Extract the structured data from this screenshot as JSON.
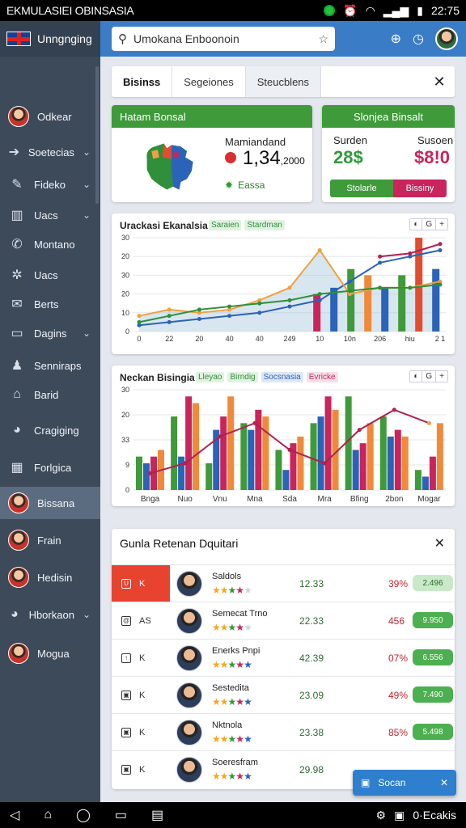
{
  "status_bar": {
    "title": "EKMULASIEI OBINSASIA",
    "time": "22:75",
    "icons": [
      "record-icon",
      "alarm-icon",
      "wifi-icon",
      "signal-icon",
      "battery-icon"
    ]
  },
  "sidebar": {
    "header_label": "Unngnging",
    "items": [
      {
        "label": "Odkear",
        "icon": "avatar",
        "chevron": false
      },
      {
        "label": "Soetecias",
        "icon": "arrow-icon",
        "chevron": true
      },
      {
        "label": "Fideko",
        "icon": "pen-icon",
        "chevron": true
      },
      {
        "label": "Uacs",
        "icon": "chart-icon",
        "chevron": true
      },
      {
        "label": "Montano",
        "icon": "phone-icon",
        "chevron": false
      },
      {
        "label": "Uacs",
        "icon": "gear-icon",
        "chevron": false
      },
      {
        "label": "Berts",
        "icon": "mail-icon",
        "chevron": false
      },
      {
        "label": "Dagins",
        "icon": "monitor-icon",
        "chevron": true
      },
      {
        "label": "Senniraps",
        "icon": "user-icon",
        "chevron": false
      },
      {
        "label": "Barid",
        "icon": "home-icon",
        "chevron": false
      },
      {
        "label": "Cragiging",
        "icon": "colorwheel-icon",
        "chevron": false
      },
      {
        "label": "Forlgica",
        "icon": "grid-icon",
        "chevron": false
      },
      {
        "label": "Bissana",
        "icon": "avatar",
        "chevron": false
      },
      {
        "label": "Frain",
        "icon": "avatar",
        "chevron": false
      },
      {
        "label": "Hedisin",
        "icon": "avatar",
        "chevron": false
      },
      {
        "label": "Hborkaon",
        "icon": "colorwheel-icon",
        "chevron": true
      },
      {
        "label": "Mogua",
        "icon": "avatar",
        "chevron": false
      }
    ]
  },
  "topbar": {
    "search_value": "Umokana Enboonoin"
  },
  "tabs": [
    "Bisinss",
    "Segeiones",
    "Steucblens"
  ],
  "kpi_left": {
    "header": "Hatam Bonsal",
    "label": "Mamiandand",
    "value": "1,34",
    "value_suffix": ",2000",
    "sub": "Eassa"
  },
  "kpi_right": {
    "header": "Slonjea Binsalt",
    "col1_label": "Surden",
    "col1_value": "28$",
    "col2_label": "Susoen",
    "col2_value": "$8!0",
    "btn1": "Stolarle",
    "btn2": "Bissiny",
    "colors": {
      "value1": "#2f9a3a",
      "value2": "#c9245c",
      "btn1": "#3f9a3a",
      "btn2": "#c9245c"
    }
  },
  "chart1_tools": [
    "◐",
    "G",
    "+"
  ],
  "chart2_tools": [
    "◐",
    "G",
    "+"
  ],
  "chart_data": [
    {
      "type": "line",
      "title": "Urackasi Ekanalsia",
      "legend": [
        {
          "name": "Saraien",
          "color": "#3f9a3a"
        },
        {
          "name": "Stardman",
          "color": "#3f9a3a"
        }
      ],
      "x_ticks": [
        "0",
        "22",
        "20",
        "40",
        "40",
        "249",
        "10",
        "10n",
        "206",
        "hiu",
        "2 1"
      ],
      "y_ticks": [
        "0",
        "10",
        "20",
        "30",
        "20",
        "30"
      ],
      "ylim": [
        0,
        30
      ],
      "series": [
        {
          "color": "#2a63b8",
          "values": [
            2,
            3,
            4,
            5,
            6,
            8,
            10,
            16,
            22,
            24,
            26
          ]
        },
        {
          "color": "#f0a040",
          "values": [
            5,
            7,
            6,
            7,
            10,
            14,
            26,
            12,
            14,
            14,
            16
          ]
        },
        {
          "color": "#2f8f3a",
          "values": [
            3,
            5,
            7,
            8,
            9,
            10,
            12,
            13,
            14,
            14,
            15
          ]
        },
        {
          "color": "#b0214e",
          "values": [
            null,
            null,
            null,
            null,
            null,
            null,
            null,
            null,
            24,
            25,
            28
          ]
        }
      ],
      "bars": {
        "categories": [
          "10",
          "10n",
          "10n",
          "206",
          "206",
          "hiu",
          "hiu",
          "2 1"
        ],
        "colors": [
          "#c9245c",
          "#2a63b8",
          "#3f9a3a",
          "#f08a3a",
          "#2a63b8",
          "#3f9a3a",
          "#e24d2f",
          "#2a63b8"
        ],
        "values": [
          12,
          14,
          20,
          18,
          14,
          18,
          30,
          20
        ]
      }
    },
    {
      "type": "bar",
      "title": "Neckan Bisingia",
      "legend": [
        {
          "name": "Lleyao",
          "color": "#3f9a3a"
        },
        {
          "name": "Birndig",
          "color": "#3f9a3a"
        },
        {
          "name": "Socsnasia",
          "color": "#2a63b8"
        },
        {
          "name": "Evricke",
          "color": "#c9245c"
        }
      ],
      "categories": [
        "Bnga",
        "Nuo",
        "Vnu",
        "Mna",
        "Sda",
        "Mra",
        "Bfing",
        "2bon",
        "Mogar"
      ],
      "y_ticks": [
        "0",
        "9",
        "33",
        "20",
        "30"
      ],
      "ylim": [
        0,
        30
      ],
      "series": [
        {
          "name": "",
          "color": "#3f9a3a",
          "values": [
            10,
            22,
            8,
            20,
            12,
            20,
            28,
            22,
            6
          ]
        },
        {
          "name": "",
          "color": "#2a63b8",
          "values": [
            8,
            10,
            18,
            18,
            6,
            22,
            12,
            16,
            4
          ]
        },
        {
          "name": "",
          "color": "#c9245c",
          "values": [
            10,
            28,
            22,
            24,
            14,
            28,
            14,
            18,
            10
          ]
        },
        {
          "name": "",
          "color": "#f08a3a",
          "values": [
            12,
            26,
            28,
            22,
            16,
            24,
            20,
            16,
            20
          ]
        }
      ],
      "line": {
        "color": "#b0214e",
        "values": [
          5,
          8,
          16,
          20,
          12,
          8,
          18,
          24,
          20
        ]
      }
    }
  ],
  "list": {
    "title": "Gunla Retenan Dquitari",
    "rows": [
      {
        "lead": "K",
        "lead_icon": "U",
        "highlight": true,
        "name": "Saldols",
        "value": "12.33",
        "pct": "39%",
        "pill": "2.496",
        "pill_color": "#c9e9c9",
        "stars": 4
      },
      {
        "lead": "AS",
        "lead_icon": "@",
        "highlight": false,
        "name": "Semecat Trno",
        "value": "22.33",
        "pct": "456",
        "pill": "9.950",
        "pill_color": "#4caf50",
        "stars": 4
      },
      {
        "lead": "K",
        "lead_icon": "↑",
        "highlight": false,
        "name": "Enerks Pnpi",
        "value": "42.39",
        "pct": "07%",
        "pill": "6.556",
        "pill_color": "#4caf50",
        "stars": 5
      },
      {
        "lead": "K",
        "lead_icon": "▣",
        "highlight": false,
        "name": "Sestedita",
        "value": "23.09",
        "pct": "49%",
        "pill": "7.490",
        "pill_color": "#4caf50",
        "stars": 5
      },
      {
        "lead": "K",
        "lead_icon": "▣",
        "highlight": false,
        "name": "Nktnola",
        "value": "23.38",
        "pct": "85%",
        "pill": "5.498",
        "pill_color": "#4caf50",
        "stars": 5
      },
      {
        "lead": "K",
        "lead_icon": "▣",
        "highlight": false,
        "name": "Soeresfram",
        "value": "29.98",
        "pct": "",
        "pill": "",
        "pill_color": "#4caf50",
        "stars": 5
      }
    ]
  },
  "snackbar": {
    "label": "Socan"
  },
  "navbar": {
    "right_text": "0·Ecakis"
  }
}
